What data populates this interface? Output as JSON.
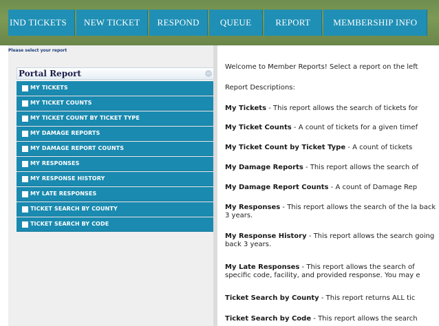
{
  "nav": {
    "tabs": [
      "IND TICKETS",
      "NEW TICKET",
      "RESPOND",
      "QUEUE",
      "REPORT",
      "MEMBERSHIP INFO"
    ]
  },
  "sidebar": {
    "hint": "Please select your report",
    "title": "Portal Report",
    "collapse_glyph": "−",
    "items": [
      {
        "label": "MY TICKETS"
      },
      {
        "label": "MY TICKET COUNTS"
      },
      {
        "label": "MY TICKET COUNT BY TICKET TYPE"
      },
      {
        "label": "MY DAMAGE REPORTS"
      },
      {
        "label": "MY DAMAGE REPORT COUNTS"
      },
      {
        "label": "MY RESPONSES"
      },
      {
        "label": "MY RESPONSE HISTORY"
      },
      {
        "label": "MY LATE RESPONSES"
      },
      {
        "label": "TICKET SEARCH BY COUNTY"
      },
      {
        "label": "TICKET SEARCH BY CODE"
      }
    ]
  },
  "main": {
    "welcome": "Welcome to Member Reports! Select a report on the left",
    "descriptions_heading": "Report Descriptions:",
    "descriptions": [
      {
        "name": "My Tickets",
        "text": " - This report allows the search of tickets for"
      },
      {
        "name": "My Ticket Counts",
        "text": " - A count of tickets for a given timef"
      },
      {
        "name": "My Ticket Count by Ticket Type",
        "text": " - A count of tickets"
      },
      {
        "name": "My Damage Reports",
        "text": " - This report allows the search of"
      },
      {
        "name": "My Damage Report Counts",
        "text": " - A count of Damage Rep"
      },
      {
        "name": "My Responses",
        "text": " - This report allows the search of the la back 3 years."
      },
      {
        "name": "My Response History",
        "text": " - This report allows the search going back 3 years."
      },
      {
        "name": "My Late Responses",
        "text": " - This report allows the search of specific code, facility, and provided response. You may e"
      },
      {
        "name": "Ticket Search by County",
        "text": " - This report returns ALL tic"
      },
      {
        "name": "Ticket Search by Code",
        "text": " - This report allows the search"
      }
    ]
  }
}
